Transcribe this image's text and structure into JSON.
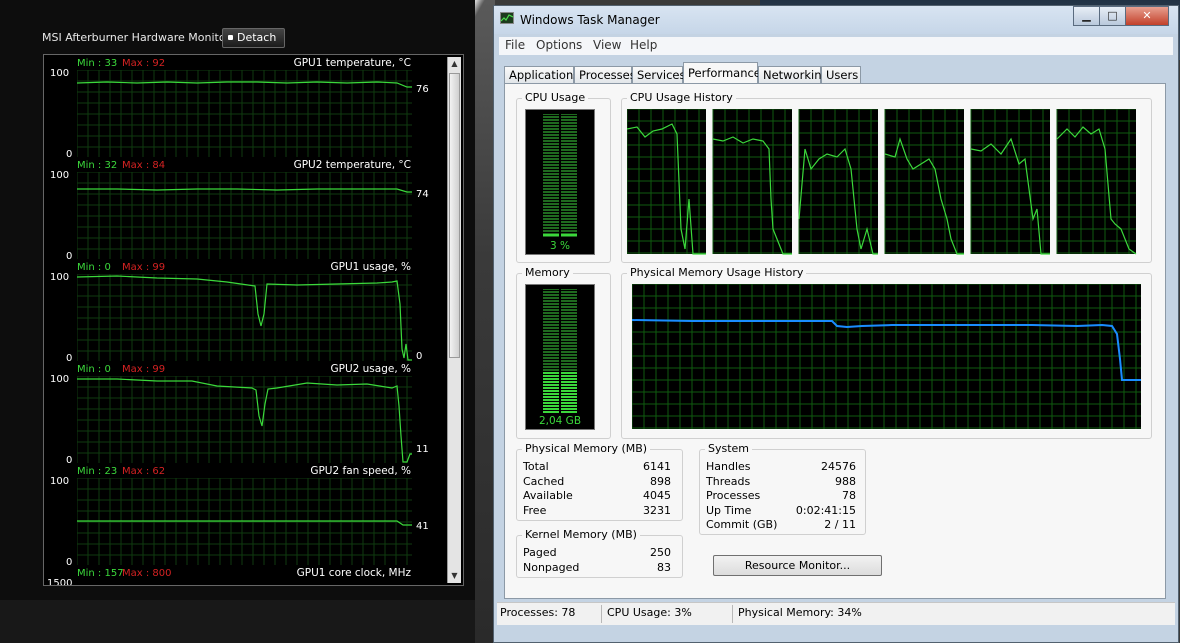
{
  "afterburner": {
    "title": "MSI Afterburner Hardware Monitor",
    "detach_label": "Detach",
    "graphs": [
      {
        "min": "Min : 33",
        "max": "Max : 92",
        "title": "GPU1 temperature, °C",
        "ymax": "100",
        "ymin": "0",
        "current": "76",
        "level": 0.8
      },
      {
        "min": "Min : 32",
        "max": "Max : 84",
        "title": "GPU2 temperature, °C",
        "ymax": "100",
        "ymin": "0",
        "current": "74",
        "level": 0.82
      },
      {
        "min": "Min : 0",
        "max": "Max : 99",
        "title": "GPU1 usage, %",
        "ymax": "100",
        "ymin": "0",
        "current": "0",
        "level": 0.99
      },
      {
        "min": "Min : 0",
        "max": "Max : 99",
        "title": "GPU2 usage, %",
        "ymax": "100",
        "ymin": "0",
        "current": "11",
        "level": 0.97
      },
      {
        "min": "Min : 23",
        "max": "Max : 62",
        "title": "GPU2 fan speed, %",
        "ymax": "100",
        "ymin": "0",
        "current": "41",
        "level": 0.5
      },
      {
        "min": "Min : 157",
        "max": "Max : 800",
        "title": "GPU1 core clock, MHz",
        "ymax": "1500",
        "ymin": "",
        "current": "",
        "level": 0
      }
    ],
    "colors": {
      "line": "#3bd83b",
      "min": "#3bd83b",
      "max": "#d42222",
      "grid": "#0f3a0f"
    }
  },
  "taskmanager": {
    "title": "Windows Task Manager",
    "window_buttons": {
      "minimize": "▁",
      "maximize": "□",
      "close": "✕"
    },
    "menu": [
      "File",
      "Options",
      "View",
      "Help"
    ],
    "tabs": [
      "Applications",
      "Processes",
      "Services",
      "Performance",
      "Networking",
      "Users"
    ],
    "active_tab": "Performance",
    "cpu_usage": {
      "label": "CPU Usage",
      "value": "3 %",
      "fraction": 0.03
    },
    "cpu_history_label": "CPU Usage History",
    "memory": {
      "label": "Memory",
      "value": "2,04 GB",
      "fraction": 0.34
    },
    "mem_history_label": "Physical Memory Usage History",
    "physical_memory": {
      "label": "Physical Memory (MB)",
      "rows": [
        {
          "name": "Total",
          "value": "6141"
        },
        {
          "name": "Cached",
          "value": "898"
        },
        {
          "name": "Available",
          "value": "4045"
        },
        {
          "name": "Free",
          "value": "3231"
        }
      ]
    },
    "kernel_memory": {
      "label": "Kernel Memory (MB)",
      "rows": [
        {
          "name": "Paged",
          "value": "250"
        },
        {
          "name": "Nonpaged",
          "value": "83"
        }
      ]
    },
    "system": {
      "label": "System",
      "rows": [
        {
          "name": "Handles",
          "value": "24576"
        },
        {
          "name": "Threads",
          "value": "988"
        },
        {
          "name": "Processes",
          "value": "78"
        },
        {
          "name": "Up Time",
          "value": "0:02:41:15"
        },
        {
          "name": "Commit (GB)",
          "value": "2 / 11"
        }
      ]
    },
    "resource_monitor_label": "Resource Monitor...",
    "status": {
      "processes": "Processes: 78",
      "cpu": "CPU Usage: 3%",
      "memory": "Physical Memory: 34%"
    }
  }
}
